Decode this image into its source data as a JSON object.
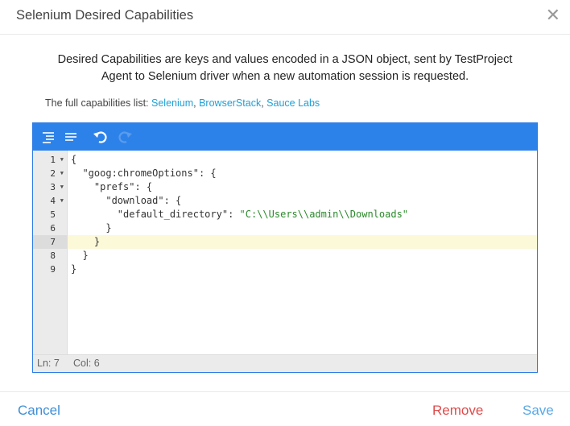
{
  "dialog": {
    "title": "Selenium Desired Capabilities",
    "close_icon": "close-icon"
  },
  "description": {
    "line1": "Desired Capabilities are keys and values encoded in a JSON object, sent by TestProject",
    "line2": "Agent to Selenium driver when a new automation session is requested."
  },
  "capabilities_list": {
    "prefix": "The full capabilities list:",
    "links": [
      "Selenium",
      "BrowserStack",
      "Sauce Labs"
    ],
    "sep": ", "
  },
  "editor": {
    "toolbar": {
      "buttons": [
        "format-icon",
        "compact-icon",
        "undo-icon",
        "redo-icon"
      ]
    },
    "lines": [
      {
        "num": "1",
        "fold": true,
        "text": "{"
      },
      {
        "num": "2",
        "fold": true,
        "text": "  \"goog:chromeOptions\": {"
      },
      {
        "num": "3",
        "fold": true,
        "text": "    \"prefs\": {"
      },
      {
        "num": "4",
        "fold": true,
        "text": "      \"download\": {"
      },
      {
        "num": "5",
        "fold": false,
        "key": "        \"default_directory\": ",
        "value": "\"C:\\\\Users\\\\admin\\\\Downloads\""
      },
      {
        "num": "6",
        "fold": false,
        "text": "      }"
      },
      {
        "num": "7",
        "fold": false,
        "text": "    }",
        "active": true
      },
      {
        "num": "8",
        "fold": false,
        "text": "  }"
      },
      {
        "num": "9",
        "fold": false,
        "text": "}"
      }
    ],
    "status": {
      "ln": "Ln: 7",
      "col": "Col: 6"
    }
  },
  "footer": {
    "cancel": "Cancel",
    "remove": "Remove",
    "save": "Save"
  },
  "colors": {
    "toolbar": "#2d82ea",
    "link": "#1e9fd6",
    "remove": "#e04b4b",
    "save": "#5aa9e6",
    "cancel": "#3d8fd6"
  }
}
